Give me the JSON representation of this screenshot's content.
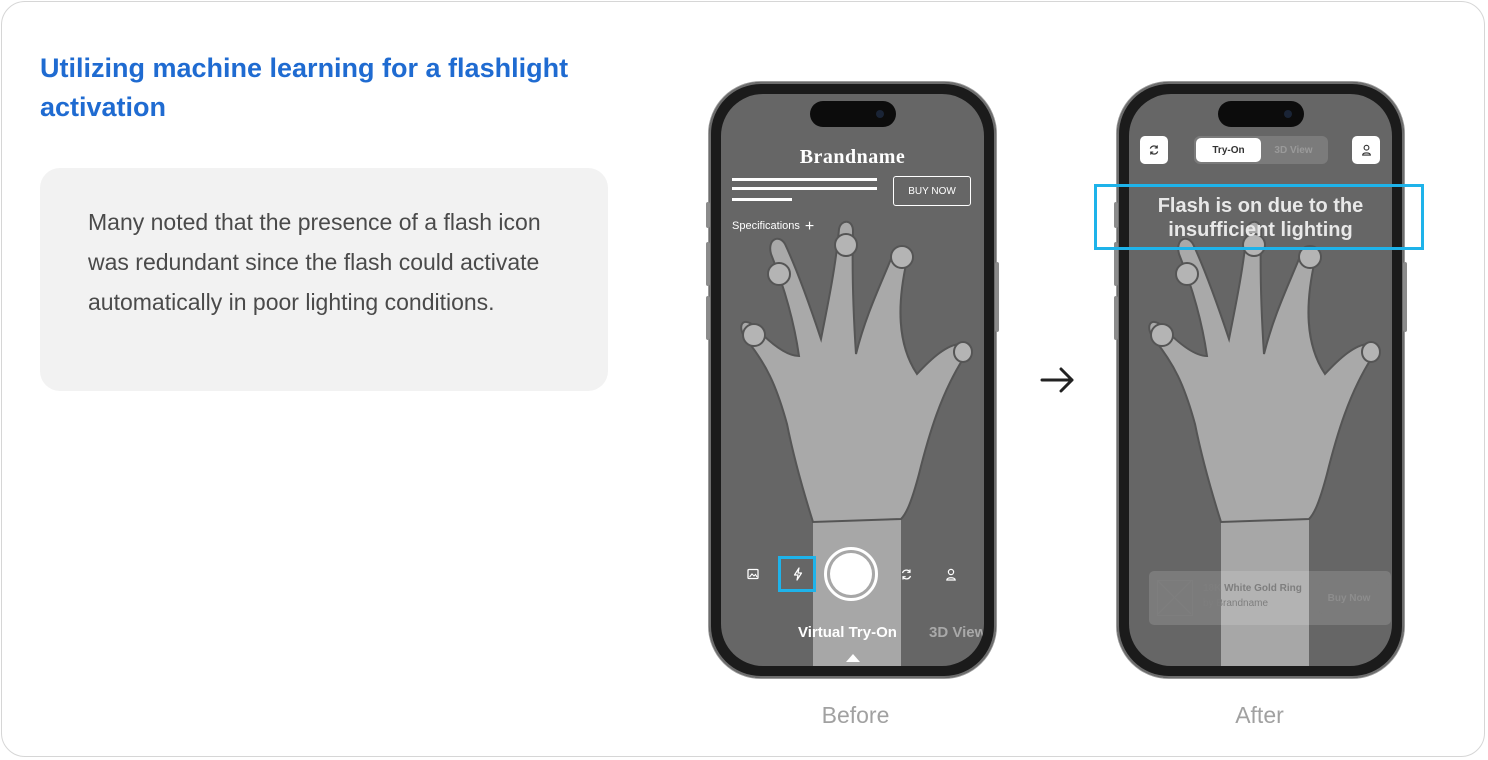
{
  "heading": "Utilizing machine learning for a flashlight activation",
  "note": {
    "text": "Many noted that the presence of a flash icon was redundant since the flash could activate automatically in poor lighting conditions."
  },
  "before_phone": {
    "brand": "Brandname",
    "buy_now": "BUY NOW",
    "specifications": "Specifications",
    "plus": "+",
    "controls": [
      "gallery-icon",
      "flash-icon",
      "shutter",
      "switch-camera-icon",
      "person-icon"
    ],
    "modes": {
      "active": "Virtual Try-On",
      "inactive": "3D View"
    }
  },
  "after_phone": {
    "segment": {
      "active": "Try-On",
      "inactive": "3D View"
    },
    "toast": {
      "line1": "Flash is on due to the",
      "line2": "insufficient lighting"
    },
    "product": {
      "name": "18K White Gold Ring",
      "by": "by Brandname",
      "buy": "Buy Now"
    }
  },
  "captions": {
    "before": "Before",
    "after": "After"
  },
  "colors": {
    "heading": "#1f6bd1",
    "highlight": "#1eb3ea",
    "screen": "#666666",
    "hand": "#aaaaaa"
  }
}
